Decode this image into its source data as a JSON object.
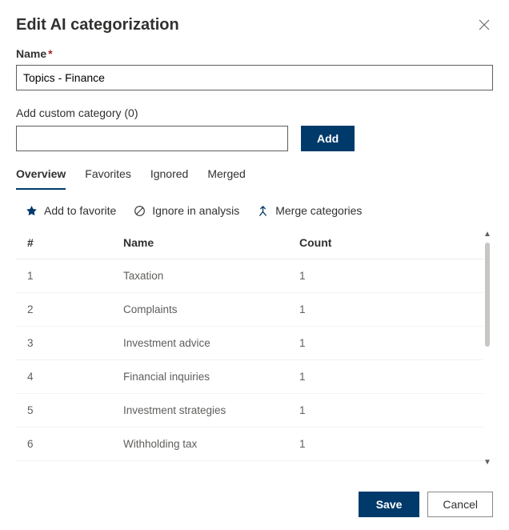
{
  "dialog": {
    "title": "Edit AI categorization",
    "close_label": "Close"
  },
  "name_field": {
    "label": "Name",
    "required_marker": "*",
    "value": "Topics - Finance"
  },
  "custom_category": {
    "label": "Add custom category (0)",
    "input_value": "",
    "add_button": "Add"
  },
  "tabs": {
    "items": [
      {
        "label": "Overview",
        "active": true
      },
      {
        "label": "Favorites",
        "active": false
      },
      {
        "label": "Ignored",
        "active": false
      },
      {
        "label": "Merged",
        "active": false
      }
    ]
  },
  "row_actions": {
    "favorite": "Add to favorite",
    "ignore": "Ignore in analysis",
    "merge": "Merge categories"
  },
  "table": {
    "headers": {
      "index": "#",
      "name": "Name",
      "count": "Count"
    },
    "rows": [
      {
        "index": "1",
        "name": "Taxation",
        "count": "1"
      },
      {
        "index": "2",
        "name": "Complaints",
        "count": "1"
      },
      {
        "index": "3",
        "name": "Investment advice",
        "count": "1"
      },
      {
        "index": "4",
        "name": "Financial inquiries",
        "count": "1"
      },
      {
        "index": "5",
        "name": "Investment strategies",
        "count": "1"
      },
      {
        "index": "6",
        "name": "Withholding tax",
        "count": "1"
      }
    ]
  },
  "footer": {
    "save": "Save",
    "cancel": "Cancel"
  }
}
